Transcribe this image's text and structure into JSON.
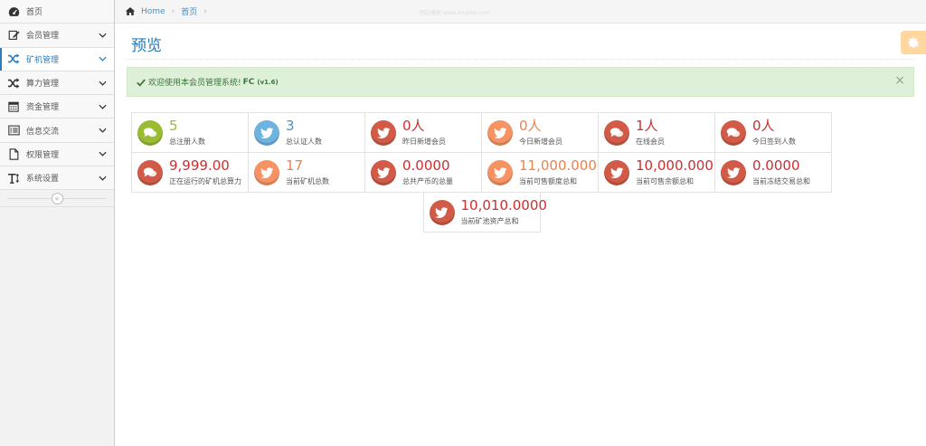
{
  "sidebar": {
    "items": [
      {
        "label": "首页",
        "icon": "tachometer-icon",
        "active": false,
        "has_chevron": false
      },
      {
        "label": "会员管理",
        "icon": "edit-icon",
        "active": false,
        "has_chevron": true
      },
      {
        "label": "矿机管理",
        "icon": "random-icon",
        "active": true,
        "has_chevron": true
      },
      {
        "label": "算力管理",
        "icon": "random-icon",
        "active": false,
        "has_chevron": true
      },
      {
        "label": "资金管理",
        "icon": "calendar-icon",
        "active": false,
        "has_chevron": true
      },
      {
        "label": "信息交流",
        "icon": "list-alt-icon",
        "active": false,
        "has_chevron": true
      },
      {
        "label": "权限管理",
        "icon": "file-icon",
        "active": false,
        "has_chevron": true
      },
      {
        "label": "系统设置",
        "icon": "text-height-icon",
        "active": false,
        "has_chevron": true
      }
    ],
    "collapse_label": "«"
  },
  "breadcrumb": {
    "home": "Home",
    "current": "首页",
    "watermark": "网站模板 www.xxxbbs.com"
  },
  "page": {
    "title": "预览"
  },
  "alert": {
    "text": "欢迎使用本会员管理系统!",
    "brand": "FC",
    "version": "(v1.6)",
    "close": "×"
  },
  "colors": {
    "green": "#9abc32",
    "blue": "#6fb3e0",
    "red": "#d15b47",
    "orange": "#f79263",
    "accent": "#2b7dbc"
  },
  "stats": {
    "row1": [
      {
        "value": "5",
        "caption": "总注册人数",
        "color": "green",
        "icon": "comments-icon"
      },
      {
        "value": "3",
        "caption": "总认证人数",
        "color": "blue",
        "icon": "twitter-icon"
      },
      {
        "value": "0人",
        "caption": "昨日新增会员",
        "color": "red",
        "icon": "twitter-icon"
      },
      {
        "value": "0人",
        "caption": "今日新增会员",
        "color": "orange",
        "icon": "twitter-icon"
      },
      {
        "value": "1人",
        "caption": "在线会员",
        "color": "red",
        "icon": "comments-icon"
      },
      {
        "value": "0人",
        "caption": "今日签到人数",
        "color": "red",
        "icon": "comments-icon"
      }
    ],
    "row2": [
      {
        "value": "9,999.00",
        "caption": "正在运行的矿机总算力",
        "color": "red",
        "icon": "comments-icon"
      },
      {
        "value": "17",
        "caption": "当前矿机总数",
        "color": "orange",
        "icon": "twitter-icon"
      },
      {
        "value": "0.0000",
        "caption": "总共产币的总量",
        "color": "red",
        "icon": "twitter-icon"
      },
      {
        "value": "11,000.0000",
        "caption": "当前可售额度总和",
        "color": "orange",
        "icon": "twitter-icon"
      },
      {
        "value": "10,000.0000",
        "caption": "当前可售余额总和",
        "color": "red",
        "icon": "twitter-icon"
      },
      {
        "value": "0.0000",
        "caption": "当前冻结交易总和",
        "color": "red",
        "icon": "twitter-icon"
      }
    ],
    "row3": [
      {
        "value": "10,010.0000",
        "caption": "当前矿池资产总和",
        "color": "red",
        "icon": "twitter-icon"
      }
    ]
  }
}
